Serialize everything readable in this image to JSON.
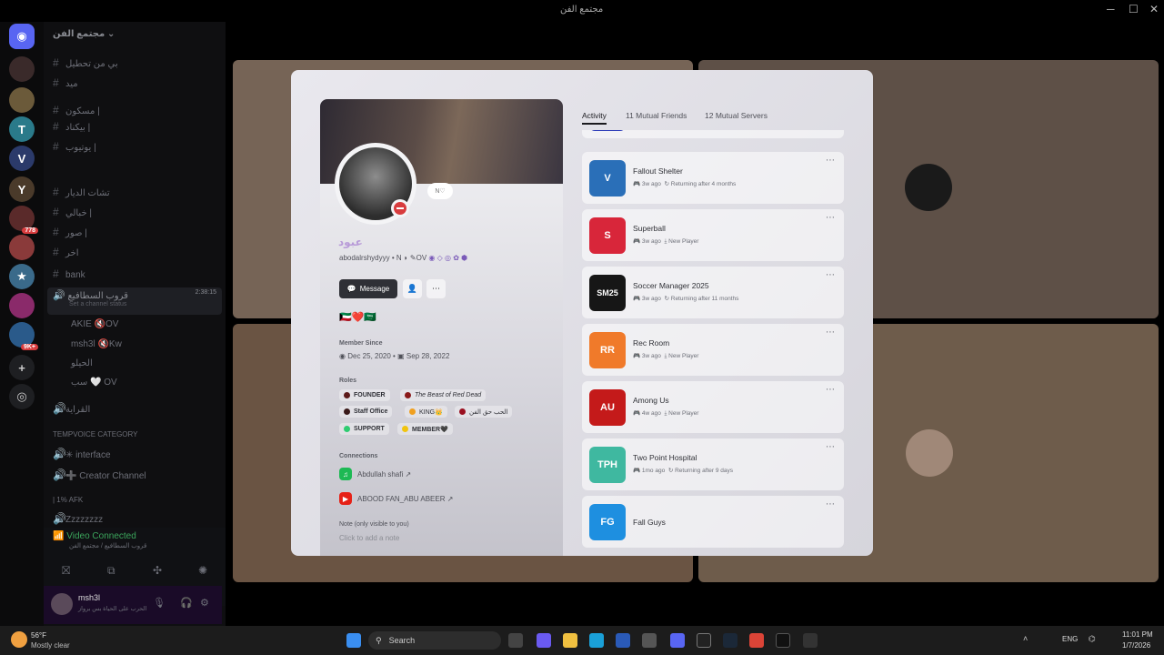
{
  "window": {
    "title": "مجتمع الفن"
  },
  "server": {
    "name": "مجتمع الفن"
  },
  "channels": {
    "items": [
      "بي من تحطيل",
      "ميد",
      "مسكون |",
      "بيكناد |",
      "يوتيوب |",
      "تشات الديار",
      "خبالي |",
      "صور |",
      "اخر",
      "bank"
    ],
    "voice_channel": "قروب السطافيع",
    "voice_status": "Set a channel status",
    "voice_time": "2:38:15",
    "members": [
      "AKIE 🔇OV",
      "msh3l 🔇Kw",
      "الحيلو",
      "سب 🤍 OV"
    ],
    "afk_label": "القراية",
    "tempvoice_category": "TEMPVOICE CATEGORY",
    "interface": "interface",
    "creator_channel": "Creator Channel",
    "afk_cat": "| 1% AFK",
    "zz": "Zzzzzzzz"
  },
  "voice_connected": {
    "label": "Video Connected",
    "sub": "قروب السطافيع / مجتمع الفن"
  },
  "user_panel": {
    "name": "msh3l",
    "status": "الحرب على الحياة بس برواز"
  },
  "profile": {
    "display_name": "عبود",
    "username": "abodalrshydyyy",
    "tag_extra": "N",
    "tag_clan": "OV",
    "message_button": "Message",
    "flags": "🇰🇼❤️🇸🇦",
    "member_since_label": "Member Since",
    "member_since_discord": "Dec 25, 2020",
    "member_since_server": "Sep 28, 2022",
    "roles_label": "Roles",
    "roles": [
      {
        "name": "FOUNDER",
        "color": "#5c1a1a"
      },
      {
        "name": "The Beast of Red Dead",
        "color": "#8a1a1a"
      },
      {
        "name": "Staff Office",
        "color": "#3a1a1a"
      },
      {
        "name": "KING👑",
        "color": "#f0a020"
      },
      {
        "name": "الحب حق الفن",
        "color": "#9a1020"
      },
      {
        "name": "SUPPORT",
        "color": "#2ecc71"
      },
      {
        "name": "MEMBER🖤",
        "color": "#f1c40f"
      }
    ],
    "connections_label": "Connections",
    "connections": [
      {
        "name": "Abdullah shafi ↗",
        "icon": "spotify-icon",
        "color": "#1db954"
      },
      {
        "name": "ABOOD FAN_ABU ABEER ↗",
        "icon": "youtube-icon",
        "color": "#e62117"
      }
    ],
    "note_label": "Note (only visible to you)",
    "note_placeholder": "Click to add a note"
  },
  "tabs": {
    "activity": "Activity",
    "mutual_friends": "11 Mutual Friends",
    "mutual_servers": "12 Mutual Servers"
  },
  "activities": [
    {
      "name": "Fallout Shelter",
      "time": "3w ago",
      "status": "Returning after 4 months",
      "icon_text": "V",
      "color": "#2a6fb8"
    },
    {
      "name": "Superball",
      "time": "3w ago",
      "status": "New Player",
      "icon_text": "S",
      "color": "#d8263a"
    },
    {
      "name": "Soccer Manager 2025",
      "time": "3w ago",
      "status": "Returning after 11 months",
      "icon_text": "SM25",
      "color": "#161616"
    },
    {
      "name": "Rec Room",
      "time": "3w ago",
      "status": "New Player",
      "icon_text": "RR",
      "color": "#f07a2a"
    },
    {
      "name": "Among Us",
      "time": "4w ago",
      "status": "New Player",
      "icon_text": "AU",
      "color": "#c41a1a"
    },
    {
      "name": "Two Point Hospital",
      "time": "1mo ago",
      "status": "Returning after 9 days",
      "icon_text": "TPH",
      "color": "#3fb8a0"
    },
    {
      "name": "Fall Guys",
      "time": "",
      "status": "",
      "icon_text": "FG",
      "color": "#1e8fe0"
    }
  ],
  "taskbar": {
    "weather_temp": "56°F",
    "weather_desc": "Mostly clear",
    "search_placeholder": "Search",
    "lang": "ENG",
    "time": "11:01 PM",
    "date": "1/7/2026"
  }
}
